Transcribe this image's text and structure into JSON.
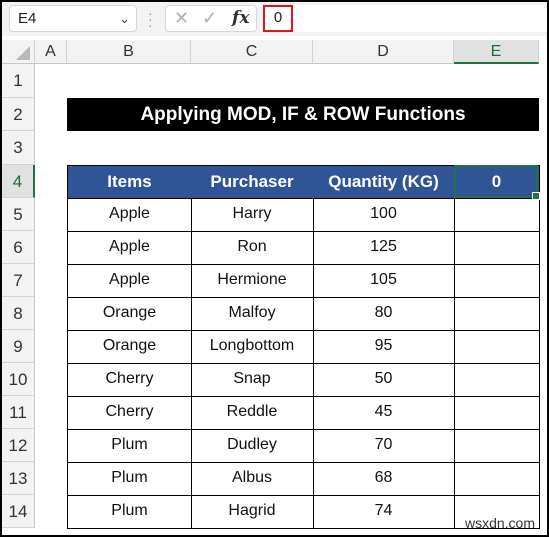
{
  "formula_bar": {
    "name_box": "E4",
    "name_box_dropdown_icon": "chevron-down-icon",
    "cancel_icon": "✕",
    "enter_icon": "✓",
    "fx_label": "fx",
    "formula_value": "0"
  },
  "columns": [
    "A",
    "B",
    "C",
    "D",
    "E"
  ],
  "selected_column": "E",
  "rows": [
    "1",
    "2",
    "3",
    "4",
    "5",
    "6",
    "7",
    "8",
    "9",
    "10",
    "11",
    "12",
    "13",
    "14"
  ],
  "selected_row": "4",
  "sheet": {
    "title": "Applying MOD, IF & ROW Functions",
    "headers": [
      "Items",
      "Purchaser",
      "Quantity (KG)",
      "0"
    ],
    "data": [
      [
        "Apple",
        "Harry",
        "100",
        ""
      ],
      [
        "Apple",
        "Ron",
        "125",
        ""
      ],
      [
        "Apple",
        "Hermione",
        "105",
        ""
      ],
      [
        "Orange",
        "Malfoy",
        "80",
        ""
      ],
      [
        "Orange",
        "Longbottom",
        "95",
        ""
      ],
      [
        "Cherry",
        "Snap",
        "50",
        ""
      ],
      [
        "Cherry",
        "Reddle",
        "45",
        ""
      ],
      [
        "Plum",
        "Dudley",
        "70",
        ""
      ],
      [
        "Plum",
        "Albus",
        "68",
        ""
      ],
      [
        "Plum",
        "Hagrid",
        "74",
        ""
      ]
    ]
  },
  "colors": {
    "header_fill": "#2f5597",
    "title_fill": "#000000",
    "selection": "#217346",
    "highlight_box": "#e0141e"
  },
  "watermark": "wsxdn.com"
}
